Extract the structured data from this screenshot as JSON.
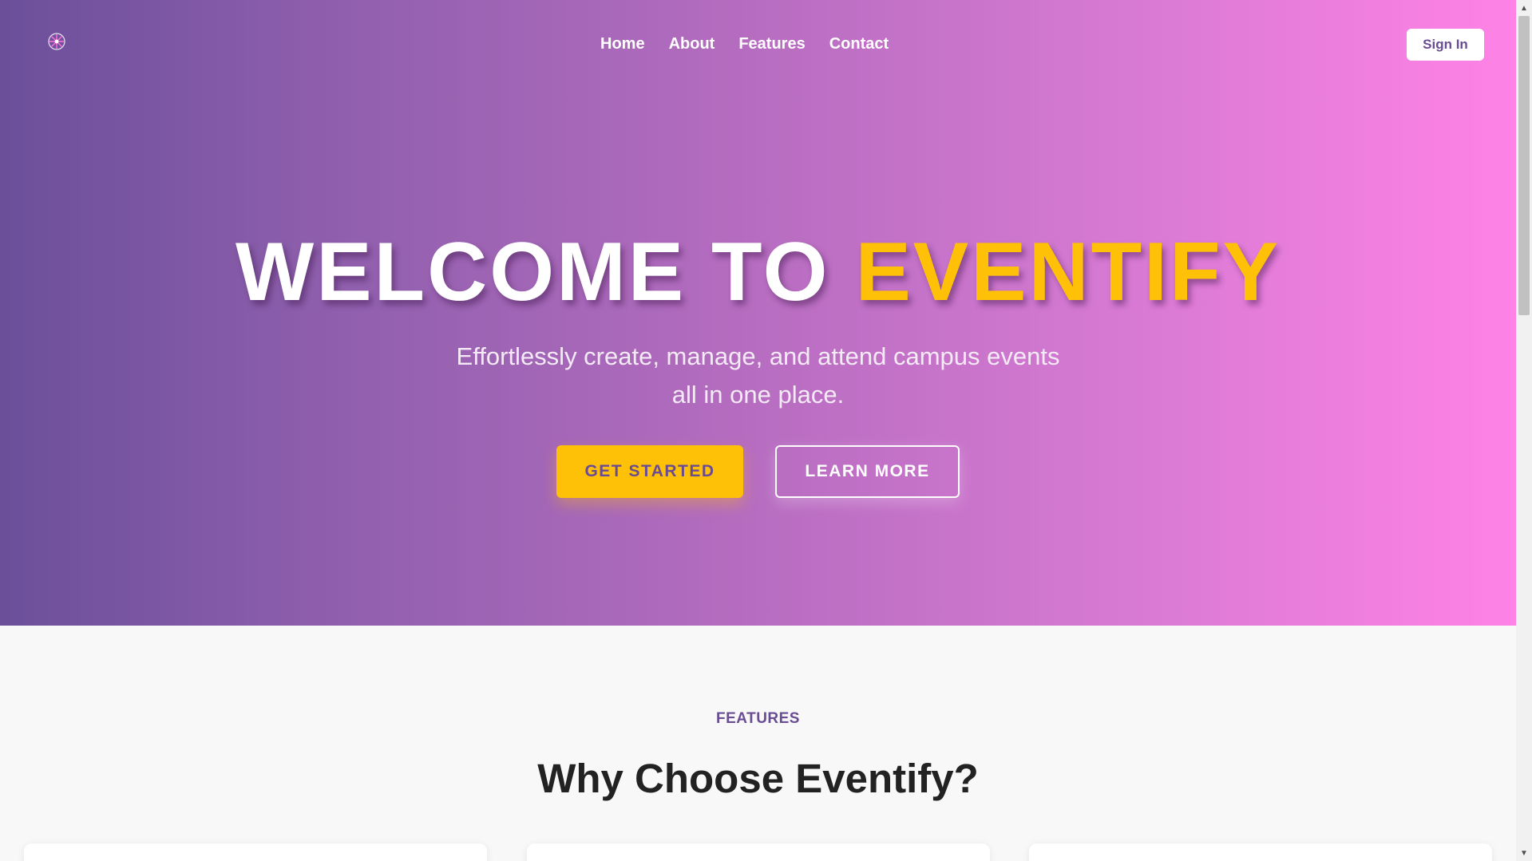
{
  "brand": {
    "logo_icon": "flower-logo-icon"
  },
  "nav": {
    "items": [
      {
        "label": "Home"
      },
      {
        "label": "About"
      },
      {
        "label": "Features"
      },
      {
        "label": "Contact"
      }
    ],
    "sign_in_label": "Sign In"
  },
  "hero": {
    "headline_prefix": "WELCOME TO",
    "headline_accent": "EVENTIFY",
    "subtitle_line1": "Effortlessly create, manage, and attend campus events",
    "subtitle_line2": "all in one place.",
    "primary_button": "GET STARTED",
    "secondary_button": "LEARN MORE"
  },
  "features": {
    "eyebrow": "FEATURES",
    "title": "Why Choose Eventify?"
  },
  "colors": {
    "gradient_start": "#6b4f9a",
    "gradient_end": "#ff82e6",
    "accent": "#ffc107",
    "brand_purple": "#6a4c93"
  }
}
